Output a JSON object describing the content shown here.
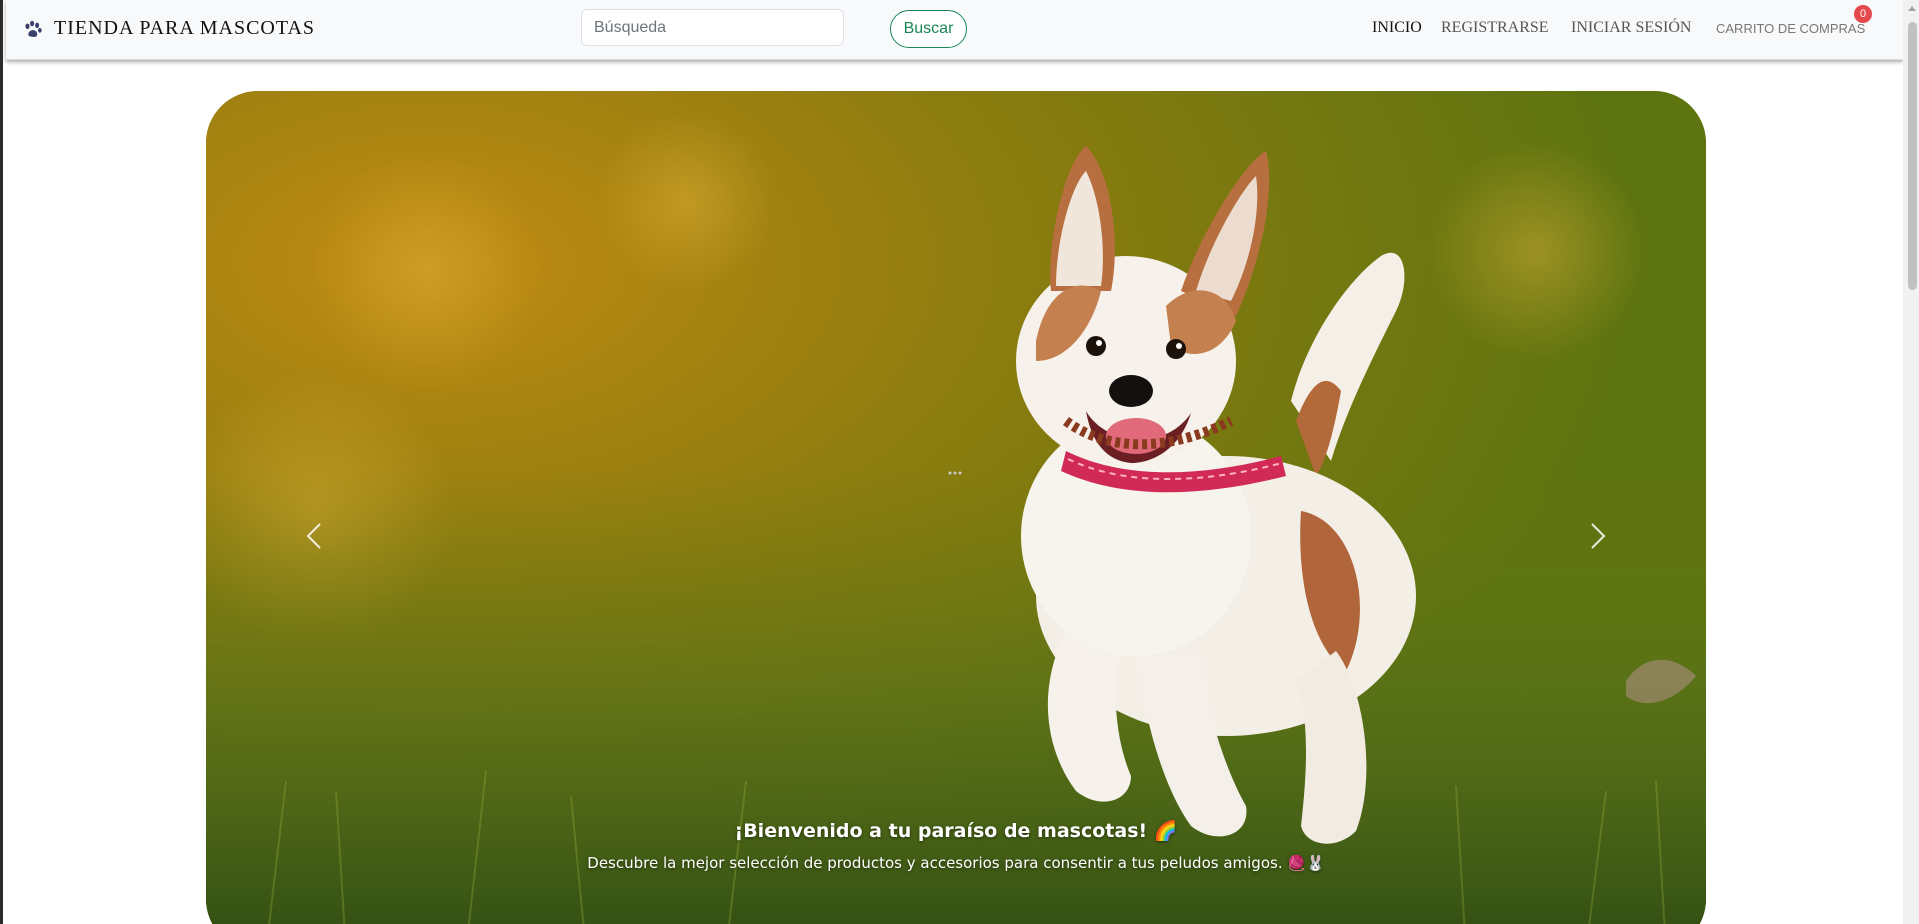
{
  "navbar": {
    "brand_icon": "paw-icon",
    "brand": "TIENDA PARA MASCOTAS",
    "search_placeholder": "Búsqueda",
    "search_value": "",
    "search_button": "Buscar",
    "links": {
      "inicio": "INICIO",
      "registrarse": "REGISTRARSE",
      "iniciar_sesion": "INICIAR SESIÓN",
      "carrito": "CARRITO DE COMPRAS"
    },
    "cart_count": "0",
    "colors": {
      "navbar_bg": "#f8f9fa",
      "search_button_accent": "#198754",
      "badge": "#e5484d"
    }
  },
  "carousel": {
    "prev_icon": "chevron-left-icon",
    "next_icon": "chevron-right-icon",
    "caption_title": "¡Bienvenido a tu paraíso de mascotas! 🌈",
    "caption_text": "Descubre la mejor selección de productos y accesorios para consentir a tus peludos amigos. 🧶🐰"
  }
}
